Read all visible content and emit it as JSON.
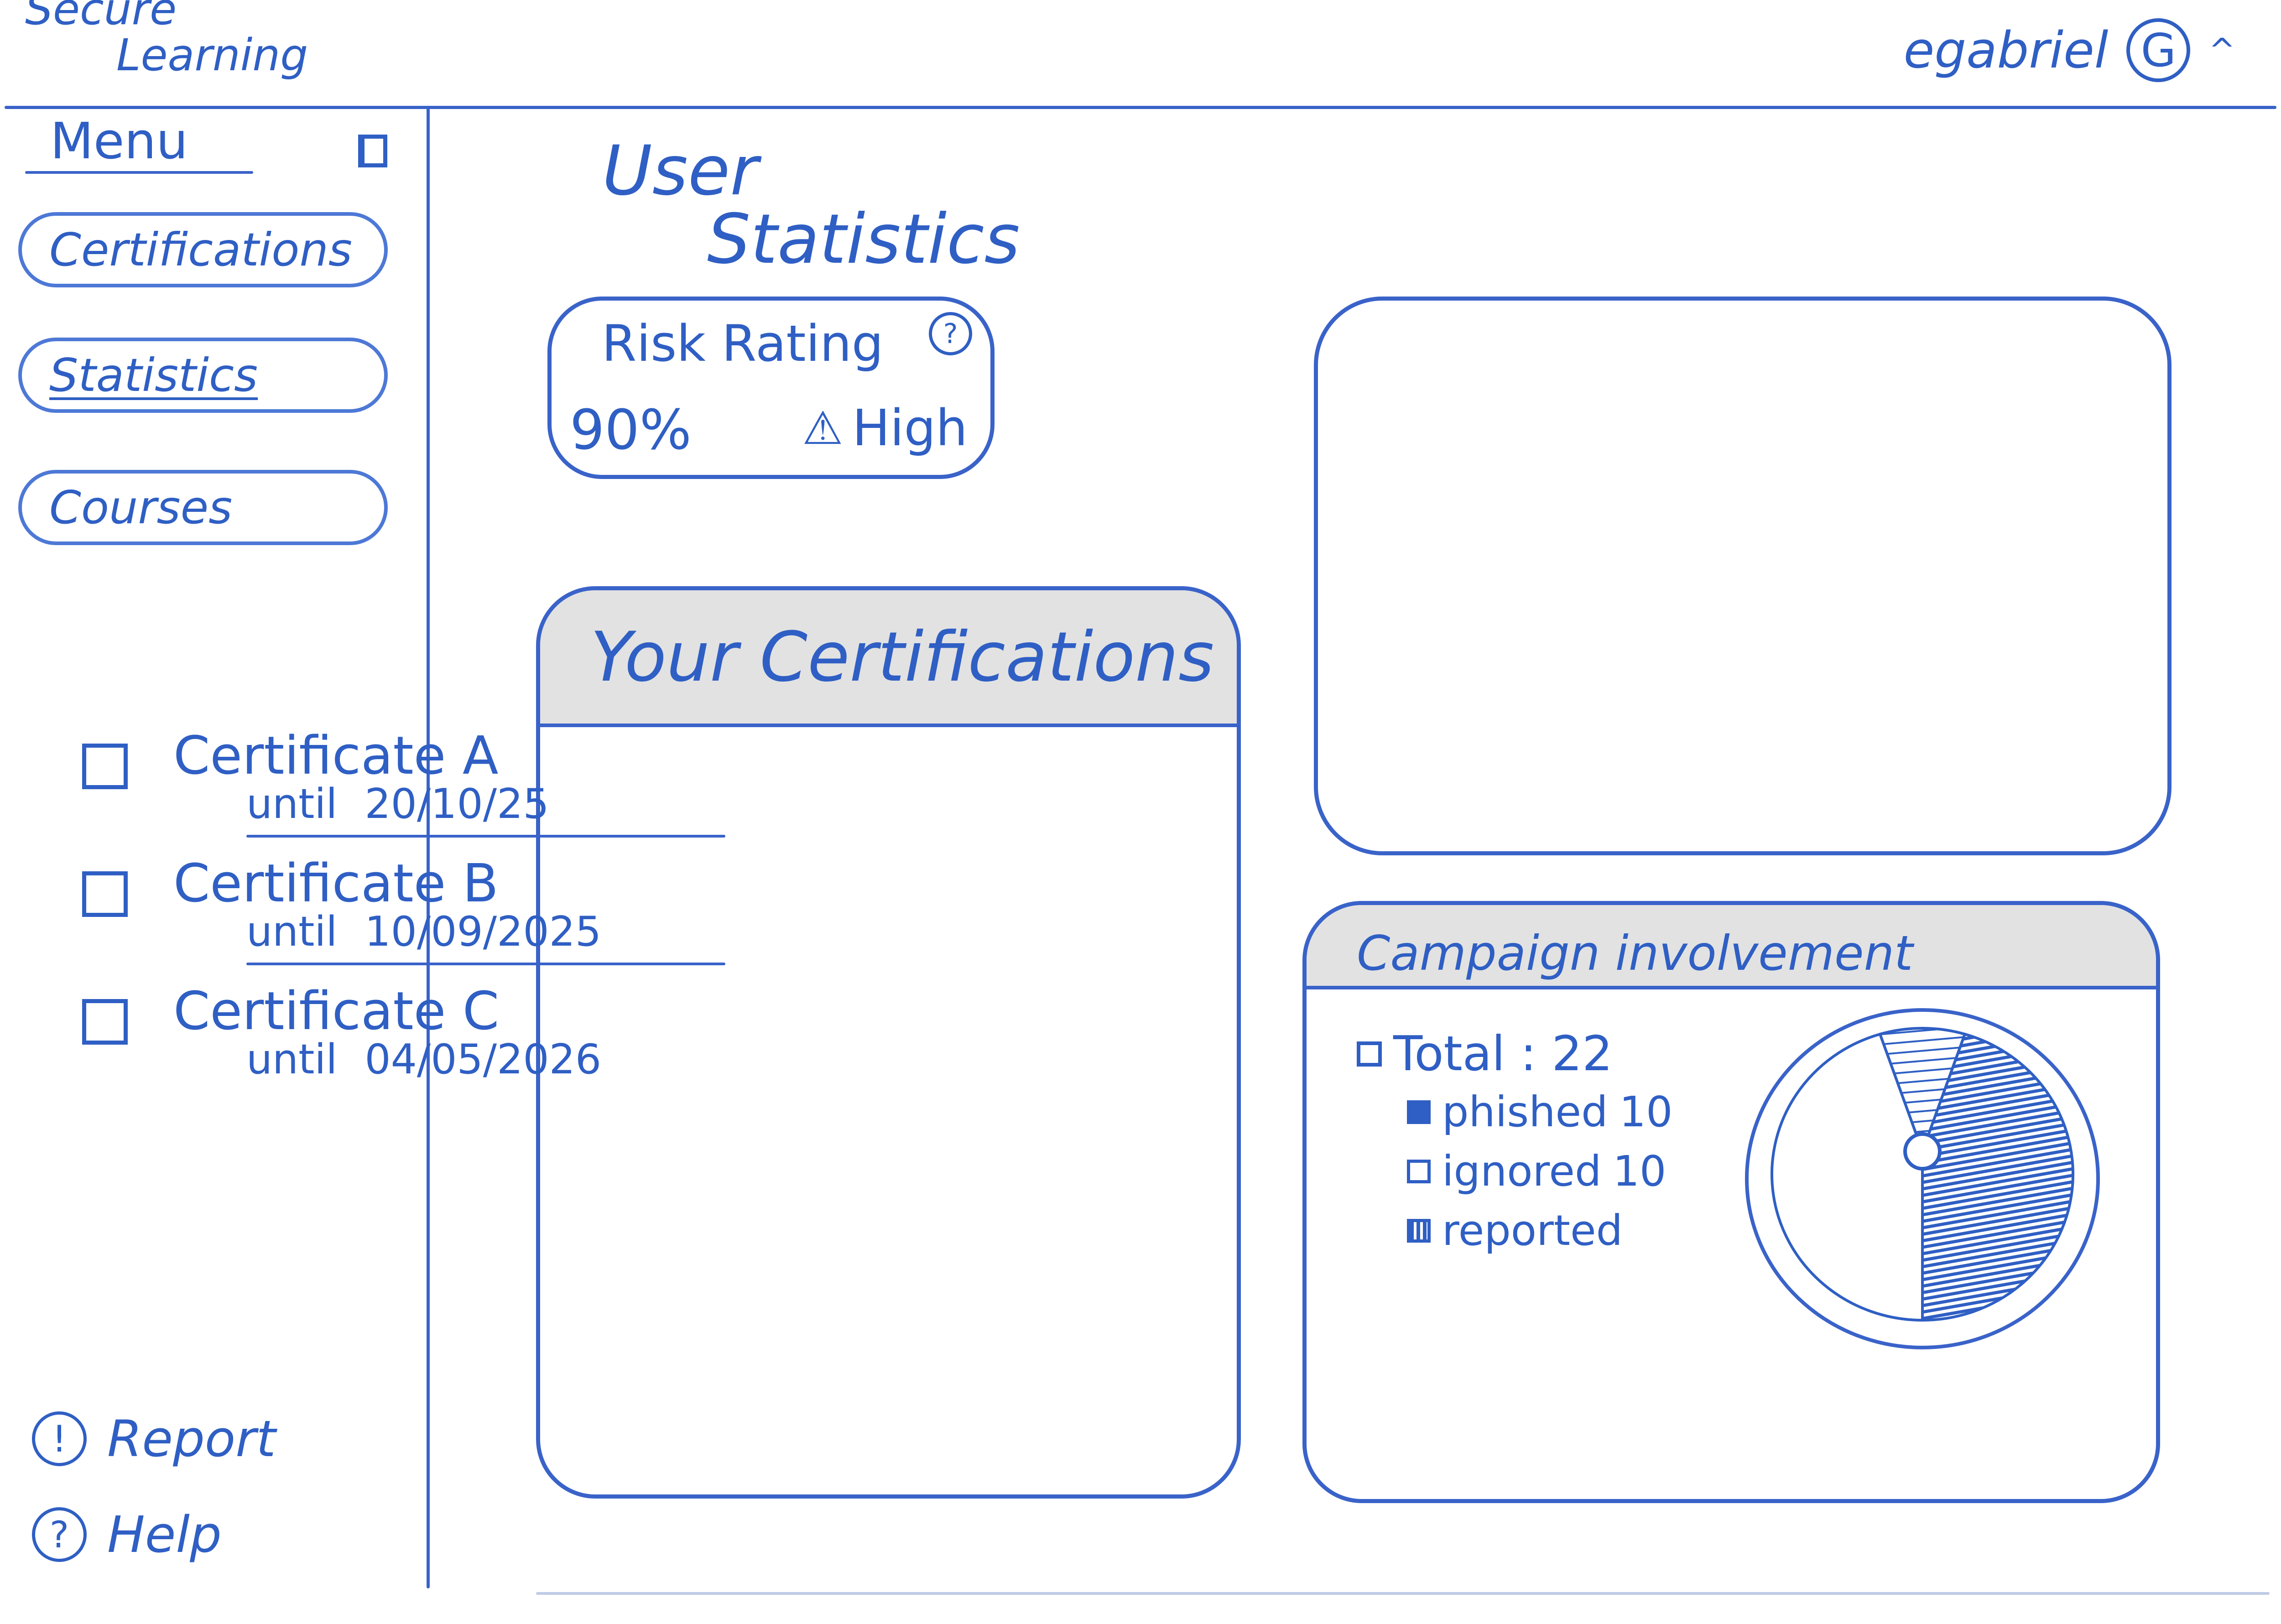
{
  "header": {
    "brand_line1": "Secure",
    "brand_line2": "Learning",
    "username": "egabriel",
    "avatar_initial": "G",
    "menu_caret": "^"
  },
  "sidebar": {
    "menu_title": "Menu",
    "items": [
      {
        "label": "Certifications"
      },
      {
        "label": "Statistics"
      },
      {
        "label": "Courses"
      }
    ],
    "report_label": "Report",
    "report_glyph": "!",
    "help_label": "Help",
    "help_glyph": "?"
  },
  "page": {
    "title_line1": "User",
    "title_line2": "Statistics"
  },
  "risk": {
    "title": "Risk Rating",
    "help_glyph": "?",
    "value": "90%",
    "level": "High",
    "warn_glyph": "⚠"
  },
  "certifications": {
    "title": "Your Certifications",
    "items": [
      {
        "name": "Certificate A",
        "until_label": "until",
        "date": "20/10/25"
      },
      {
        "name": "Certificate B",
        "until_label": "until",
        "date": "10/09/2025"
      },
      {
        "name": "Certificate C",
        "until_label": "until",
        "date": "04/05/2026"
      }
    ]
  },
  "campaign": {
    "title": "Campaign involvement",
    "total_label": "Total : 22",
    "legend": [
      {
        "label": "phished",
        "value": "10"
      },
      {
        "label": "ignored",
        "value": "10"
      },
      {
        "label": "reported",
        "value": ""
      }
    ]
  },
  "colors": {
    "ink": "#2f5fc4",
    "header_fill": "#e2e2e2"
  },
  "chart_data": {
    "type": "pie",
    "title": "",
    "slices": [
      {
        "label": "phished",
        "value": 10
      },
      {
        "label": "ignored",
        "value": 10
      },
      {
        "label": "reported",
        "value": 2
      }
    ]
  }
}
